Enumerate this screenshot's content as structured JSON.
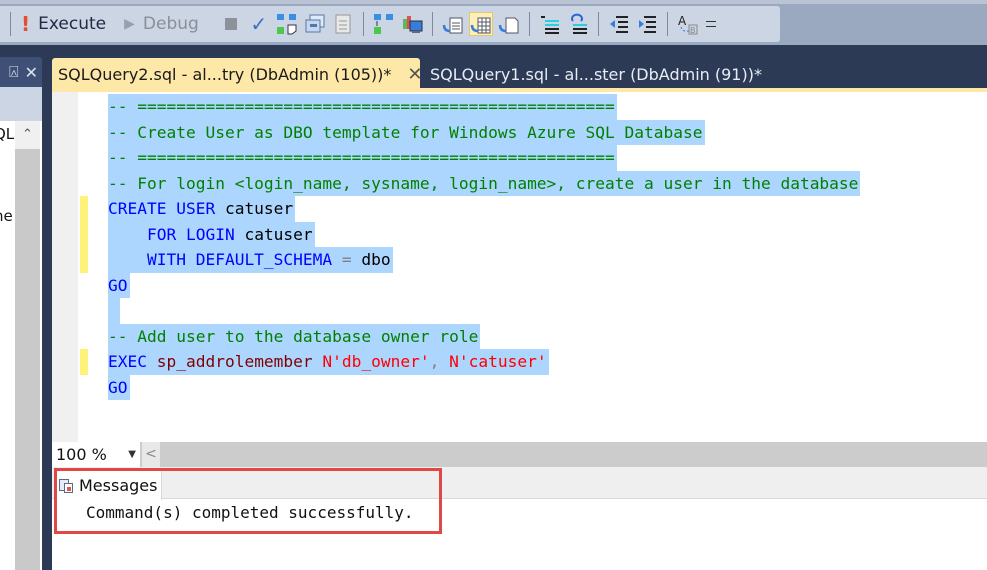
{
  "toolbar": {
    "execute_label": "Execute",
    "debug_label": "Debug",
    "icons": [
      "stop-icon",
      "parse-check-icon",
      "display-estimated-plan-icon",
      "query-options-icon",
      "intellisense-icon",
      "include-actual-plan-icon",
      "live-query-stats-icon",
      "results-to-text-icon",
      "results-to-grid-icon",
      "results-to-file-icon",
      "comment-lines-icon",
      "uncomment-lines-icon",
      "decrease-indent-icon",
      "increase-indent-icon",
      "specify-template-values-icon",
      "toolbar-overflow-icon"
    ],
    "active_icon": "results-to-grid-icon"
  },
  "left_panel": {
    "pin_glyph": "⍓",
    "close_glyph": "✕",
    "tree_fragments": [
      "QL",
      "ne"
    ]
  },
  "tabs": [
    {
      "label": "SQLQuery2.sql - al...try (DbAdmin (105))*",
      "active": true,
      "close_glyph": "✕"
    },
    {
      "label": "SQLQuery1.sql - al...ster (DbAdmin (91))*",
      "active": false
    }
  ],
  "editor": {
    "lines": [
      {
        "selected": true,
        "change": false,
        "tokens": [
          {
            "t": "comment",
            "v": "-- ================================================="
          }
        ]
      },
      {
        "selected": true,
        "change": false,
        "tokens": [
          {
            "t": "comment",
            "v": "-- Create User as DBO template for Windows Azure SQL Database"
          }
        ]
      },
      {
        "selected": true,
        "change": false,
        "tokens": [
          {
            "t": "comment",
            "v": "-- ================================================="
          }
        ]
      },
      {
        "selected": true,
        "change": false,
        "tokens": [
          {
            "t": "comment",
            "v": "-- For login <login_name, sysname, login_name>, create a user in the database"
          }
        ]
      },
      {
        "selected": true,
        "change": true,
        "tokens": [
          {
            "t": "kw",
            "v": "CREATE USER"
          },
          {
            "t": "ident",
            "v": " catuser"
          }
        ]
      },
      {
        "selected": true,
        "change": true,
        "tokens": [
          {
            "t": "ident",
            "v": "    "
          },
          {
            "t": "kw",
            "v": "FOR LOGIN"
          },
          {
            "t": "ident",
            "v": " catuser"
          }
        ]
      },
      {
        "selected": true,
        "change": true,
        "tokens": [
          {
            "t": "ident",
            "v": "    "
          },
          {
            "t": "kw",
            "v": "WITH DEFAULT_SCHEMA"
          },
          {
            "t": "op",
            "v": " = "
          },
          {
            "t": "ident",
            "v": "dbo"
          }
        ]
      },
      {
        "selected": true,
        "change": false,
        "tokens": [
          {
            "t": "kw",
            "v": "GO"
          }
        ]
      },
      {
        "selected": true,
        "change": false,
        "tokens": [
          {
            "t": "ident",
            "v": " "
          }
        ]
      },
      {
        "selected": true,
        "change": false,
        "tokens": [
          {
            "t": "comment",
            "v": "-- Add user to the database owner role"
          }
        ]
      },
      {
        "selected": true,
        "change": true,
        "tokens": [
          {
            "t": "kw",
            "v": "EXEC"
          },
          {
            "t": "ident",
            "v": " "
          },
          {
            "t": "proc",
            "v": "sp_addrolemember"
          },
          {
            "t": "ident",
            "v": " "
          },
          {
            "t": "str",
            "v": "N'db_owner'"
          },
          {
            "t": "op",
            "v": ", "
          },
          {
            "t": "str",
            "v": "N'catuser'"
          }
        ]
      },
      {
        "selected": true,
        "change": false,
        "tokens": [
          {
            "t": "kw",
            "v": "GO"
          }
        ]
      }
    ]
  },
  "zoom": {
    "value": "100 %",
    "arrow_glyph": "▼",
    "scroll_left_glyph": "<"
  },
  "results": {
    "tab_label": "Messages",
    "message": "Command(s) completed successfully."
  },
  "colors": {
    "selection": "#add6ff",
    "comment": "#008000",
    "keyword": "#0000ff",
    "string": "#ff0000",
    "procedure": "#800000",
    "active_tab": "#fde8a8",
    "highlight_box": "#e04848"
  }
}
